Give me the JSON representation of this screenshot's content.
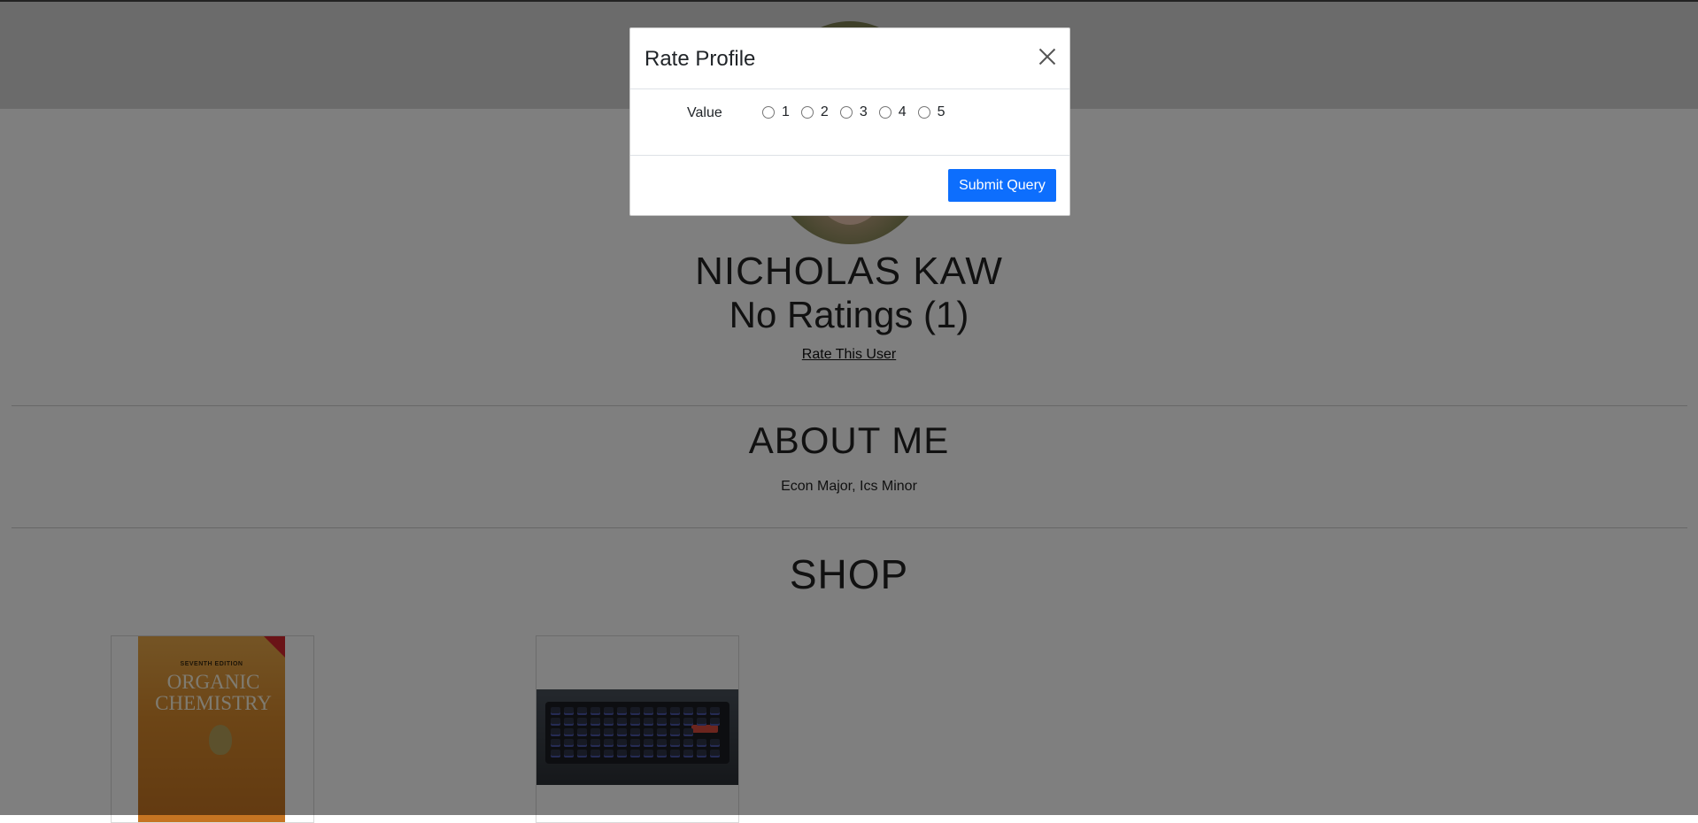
{
  "profile": {
    "name": "NICHOLAS KAW",
    "rating_text": "No Ratings (1)",
    "rate_link": "Rate This User"
  },
  "about": {
    "title": "ABOUT ME",
    "text": "Econ Major, Ics Minor"
  },
  "shop": {
    "title": "SHOP",
    "items": [
      {
        "image": "organic-chemistry-book-cover",
        "cover_edition": "SEVENTH EDITION",
        "cover_title": "ORGANIC CHEMISTRY"
      },
      {
        "image": "mechanical-keyboard-photo"
      }
    ]
  },
  "modal": {
    "title": "Rate Profile",
    "close_icon": "close-icon",
    "field_label": "Value",
    "options": [
      "1",
      "2",
      "3",
      "4",
      "5"
    ],
    "selected": null,
    "submit_label": "Submit Query"
  },
  "colors": {
    "primary_button": "#0d6efd",
    "overlay": "rgba(0,0,0,0.5)"
  }
}
